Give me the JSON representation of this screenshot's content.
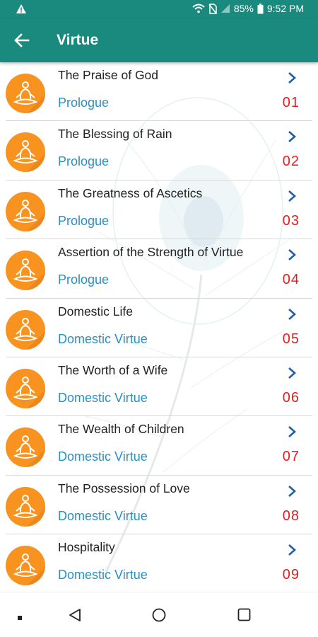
{
  "status_bar": {
    "battery": "85%",
    "time": "9:52 PM",
    "icons": [
      "warning-icon",
      "wifi-icon",
      "no-sim-icon",
      "signal-icon",
      "battery-icon"
    ]
  },
  "app_bar": {
    "title": "Virtue",
    "back_icon": "arrow-left-icon"
  },
  "colors": {
    "primary": "#1a8a7e",
    "avatar": "#f7931e",
    "category": "#2a8fc0",
    "number": "#e02020"
  },
  "chapters": [
    {
      "name": "The Praise of God",
      "category": "Prologue",
      "number": "01"
    },
    {
      "name": "The Blessing of Rain",
      "category": "Prologue",
      "number": "02"
    },
    {
      "name": "The Greatness of Ascetics",
      "category": "Prologue",
      "number": "03"
    },
    {
      "name": "Assertion of the Strength of Virtue",
      "category": "Prologue",
      "number": "04"
    },
    {
      "name": "Domestic Life",
      "category": "Domestic Virtue",
      "number": "05"
    },
    {
      "name": "The Worth of a Wife",
      "category": "Domestic Virtue",
      "number": "06"
    },
    {
      "name": "The Wealth of Children",
      "category": "Domestic Virtue",
      "number": "07"
    },
    {
      "name": "The Possession of Love",
      "category": "Domestic Virtue",
      "number": "08"
    },
    {
      "name": "Hospitality",
      "category": "Domestic Virtue",
      "number": "09"
    }
  ],
  "nav_bar": {
    "icons": [
      "dot-icon",
      "back-triangle-icon",
      "home-circle-icon",
      "recents-square-icon"
    ]
  }
}
